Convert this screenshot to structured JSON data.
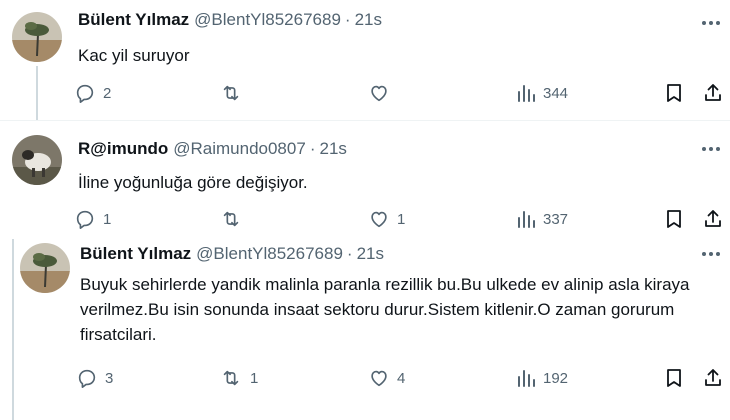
{
  "tweets": [
    {
      "name": "Bülent Yılmaz",
      "handle": "@BlentYl85267689",
      "time": "21s",
      "text": "Kac yil suruyor",
      "replies": "2",
      "retweets": "",
      "likes": "",
      "views": "344"
    },
    {
      "name": "R@imundo",
      "handle": "@Raimundo0807",
      "time": "21s",
      "text": "İline yoğunluğa göre değişiyor.",
      "replies": "1",
      "retweets": "",
      "likes": "1",
      "views": "337"
    },
    {
      "name": "Bülent Yılmaz",
      "handle": "@BlentYl85267689",
      "time": "21s",
      "text": "Buyuk sehirlerde yandik malinla paranla rezillik bu.Bu ulkede ev alinip asla kiraya verilmez.Bu isin sonunda insaat sektoru durur.Sistem kitlenir.O zaman gorurum firsatcilari.",
      "replies": "3",
      "retweets": "1",
      "likes": "4",
      "views": "192"
    }
  ],
  "separator": "·",
  "icons": [
    "more-icon",
    "reply-icon",
    "retweet-icon",
    "like-icon",
    "views-icon",
    "bookmark-icon",
    "share-icon"
  ]
}
